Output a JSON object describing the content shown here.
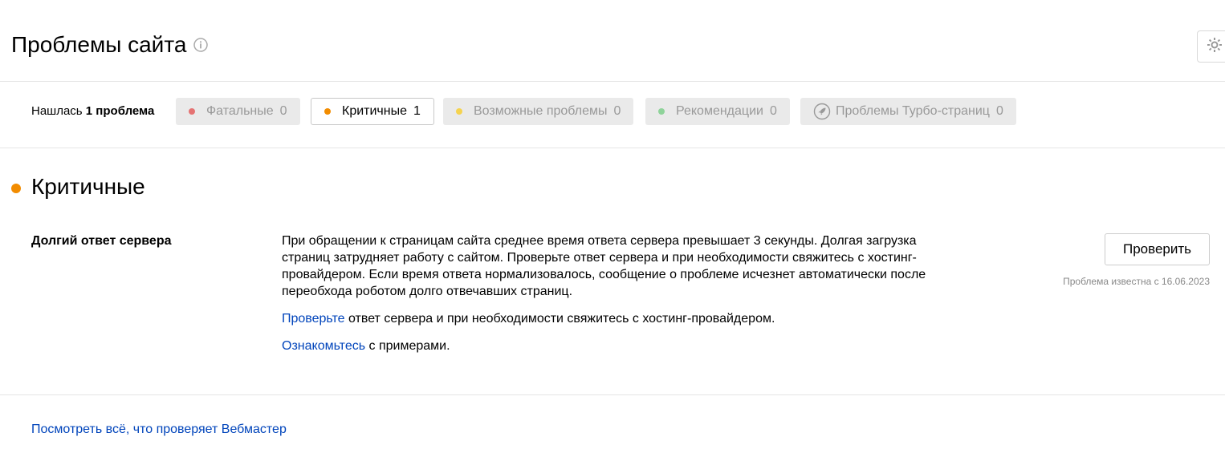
{
  "header": {
    "title": "Проблемы сайта",
    "info_icon": "info-icon",
    "settings_icon": "gear-icon"
  },
  "filters": {
    "found_prefix": "Нашлась",
    "found_count_text": "1 проблема",
    "chips": [
      {
        "label": "Фатальные",
        "count": "0",
        "color": "#e57373",
        "active": false
      },
      {
        "label": "Критичные",
        "count": "1",
        "color": "#f28c00",
        "active": true
      },
      {
        "label": "Возможные проблемы",
        "count": "0",
        "color": "#f5d34f",
        "active": false
      },
      {
        "label": "Рекомендации",
        "count": "0",
        "color": "#8fd39a",
        "active": false
      },
      {
        "label": "Проблемы Турбо-страниц",
        "count": "0",
        "icon": "rocket-icon",
        "active": false
      }
    ]
  },
  "section": {
    "title": "Критичные",
    "color": "#f28c00"
  },
  "issue": {
    "name": "Долгий ответ сервера",
    "description": "При обращении к страницам сайта среднее время ответа сервера превышает 3 секунды. Долгая загрузка страниц затрудняет работу с сайтом. Проверьте ответ сервера и при необходимости свяжитесь с хостинг-провайдером. Если время ответа нормализовалось, сообщение о проблеме исчезнет автоматически после переобхода роботом долго отвечавших страниц.",
    "hint1_link": "Проверьте",
    "hint1_text": " ответ сервера и при необходимости свяжитесь с хостинг-провайдером.",
    "hint2_link": "Ознакомьтесь",
    "hint2_text": " с примерами.",
    "check_button": "Проверить",
    "known_since": "Проблема известна с 16.06.2023"
  },
  "footer": {
    "link": "Посмотреть всё, что проверяет Вебмастер"
  },
  "colors": {
    "link": "#0044bb",
    "chip_inactive_bg": "#eaeaea"
  }
}
